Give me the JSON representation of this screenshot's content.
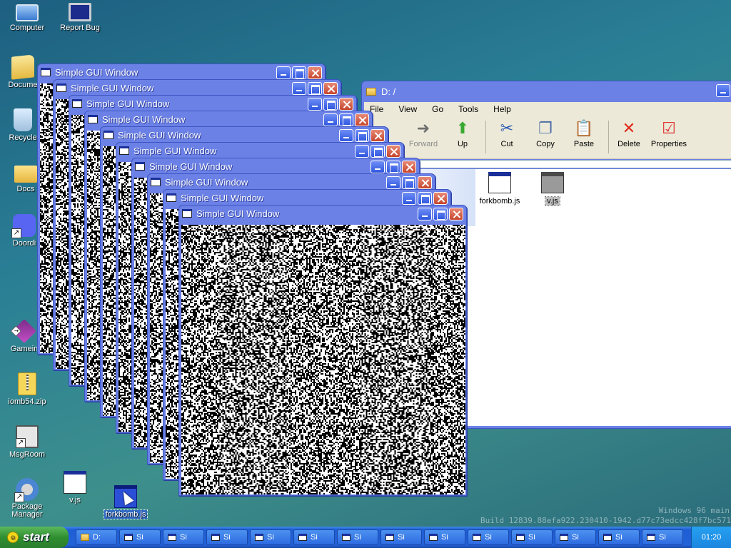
{
  "desktop": {
    "icons": [
      {
        "label": "Computer"
      },
      {
        "label": "Report Bug"
      },
      {
        "label": "Docume"
      },
      {
        "label": "Recycle"
      },
      {
        "label": "Docs"
      },
      {
        "label": "Doordi"
      },
      {
        "label": "Gamein"
      },
      {
        "label": "iomb54.zip"
      },
      {
        "label": "MsgRoom"
      },
      {
        "label": "Package Manager"
      },
      {
        "label": "v.js"
      },
      {
        "label": "forkbomb.js"
      }
    ]
  },
  "gui_windows": {
    "title": "Simple GUI Window"
  },
  "explorer": {
    "title": "D: /",
    "menu": [
      "File",
      "View",
      "Go",
      "Tools",
      "Help"
    ],
    "toolbar": {
      "forward": "Forward",
      "up": "Up",
      "cut": "Cut",
      "copy": "Copy",
      "paste": "Paste",
      "delete": "Delete",
      "properties": "Properties"
    },
    "files": [
      {
        "name": "forkbomb.js"
      },
      {
        "name": "v.js"
      }
    ]
  },
  "watermark": {
    "line1": "Windows 96 main",
    "line2": "Build 12839.88efa922.230410-1942.d77c73edcc428f7bc571"
  },
  "taskbar": {
    "start_label": "start",
    "tasks": [
      "D:",
      "Si",
      "Si",
      "Si",
      "Si",
      "Si",
      "Si",
      "Si",
      "Si",
      "Si",
      "Si",
      "Si",
      "Si",
      "Si"
    ],
    "clock": "01:20"
  },
  "colors": {
    "titlebar": "#6b81e6",
    "taskbar": "#2262d8",
    "start": "#2f8f2f",
    "close": "#c6452c"
  }
}
